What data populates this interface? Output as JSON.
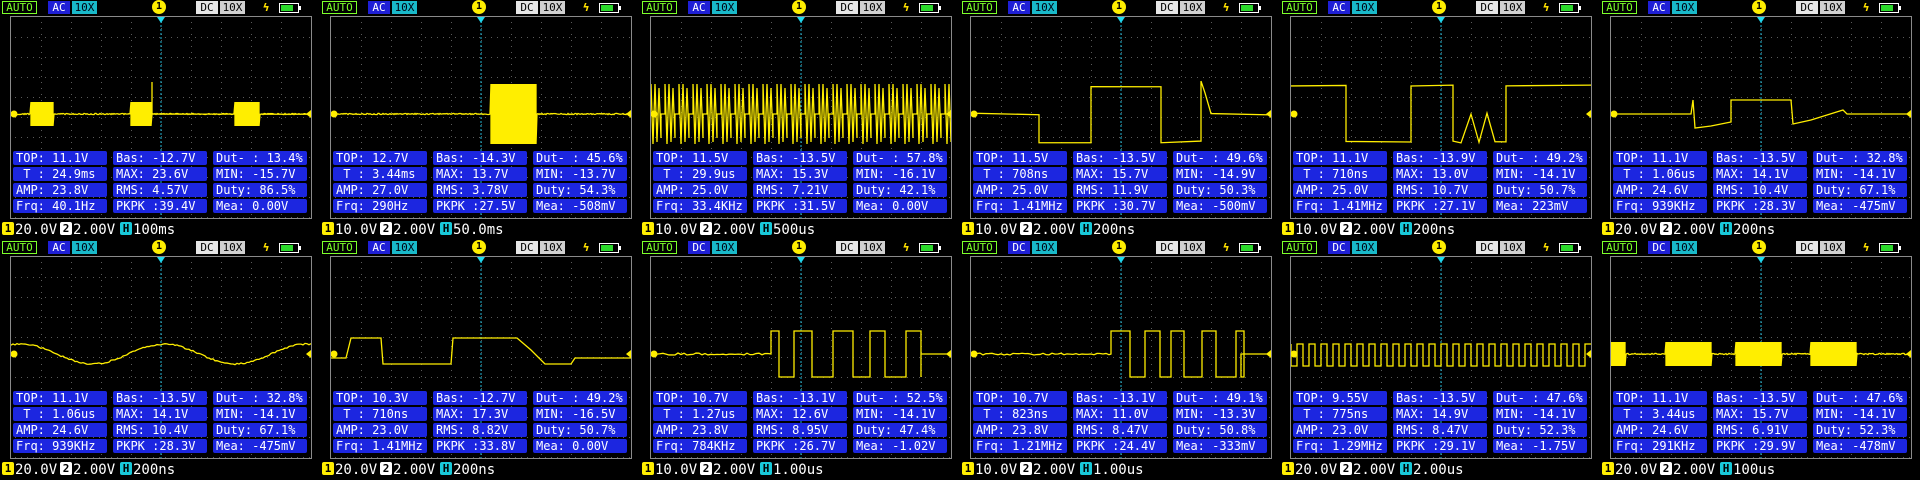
{
  "status": {
    "auto": "AUTO",
    "channel": "1",
    "coupling2": "DC",
    "probe2": "10X",
    "bolt": "ϟ"
  },
  "colors": {
    "trace": "#ffee00",
    "info_bg": "#1c26e0",
    "auto": "#7cff2a",
    "grid": "#5a5a5a"
  },
  "panels": [
    {
      "coupling": "AC",
      "probe": "10X",
      "pattern": "bursts",
      "top": "TOP: 11.1V",
      "bas": "Bas: -12.7V",
      "dut": "Dut- : 13.4%",
      "t": " T : 24.9ms",
      "max": "MAX: 23.6V",
      "min": "MIN: -15.7V",
      "amp": "AMP: 23.8V",
      "rms": "RMS: 4.57V",
      "duty": "Duty: 86.5%",
      "frq": "Frq: 40.1Hz",
      "pkpk": "PKPK :39.4V",
      "meas": "Mea: 0.00V",
      "ch1": "20.0V",
      "ch2": "2.00V",
      "h": "100ms"
    },
    {
      "coupling": "AC",
      "probe": "10X",
      "pattern": "one_burst",
      "top": "TOP: 12.7V",
      "bas": "Bas: -14.3V",
      "dut": "Dut- : 45.6%",
      "t": " T : 3.44ms",
      "max": "MAX: 13.7V",
      "min": "MIN: -13.7V",
      "amp": "AMP: 27.0V",
      "rms": "RMS: 3.78V",
      "duty": "Duty: 54.3%",
      "frq": "Frq: 290Hz",
      "pkpk": "PKPK :27.5V",
      "meas": "Mea: -508mV",
      "ch1": "10.0V",
      "ch2": "2.00V",
      "h": "50.0ms"
    },
    {
      "coupling": "AC",
      "probe": "10X",
      "pattern": "dense",
      "top": "TOP: 11.5V",
      "bas": "Bas: -13.5V",
      "dut": "Dut- : 57.8%",
      "t": " T : 29.9us",
      "max": "MAX: 15.3V",
      "min": "MIN: -16.1V",
      "amp": "AMP: 25.0V",
      "rms": "RMS: 7.21V",
      "duty": "Duty: 42.1%",
      "frq": "Frq: 33.4KHz",
      "pkpk": "PKPK :31.5V",
      "meas": "Mea: 0.00V",
      "ch1": "10.0V",
      "ch2": "2.00V",
      "h": "500us"
    },
    {
      "coupling": "AC",
      "probe": "10X",
      "pattern": "square_a",
      "top": "TOP: 11.5V",
      "bas": "Bas: -13.5V",
      "dut": "Dut- : 49.6%",
      "t": " T : 708ns",
      "max": "MAX: 15.7V",
      "min": "MIN: -14.9V",
      "amp": "AMP: 25.0V",
      "rms": "RMS: 11.9V",
      "duty": "Duty: 50.3%",
      "frq": "Frq: 1.41MHz",
      "pkpk": "PKPK :30.7V",
      "meas": "Mea: -500mV",
      "ch1": "10.0V",
      "ch2": "2.00V",
      "h": "200ns"
    },
    {
      "coupling": "AC",
      "probe": "10X",
      "pattern": "square_b",
      "top": "TOP: 11.1V",
      "bas": "Bas: -13.9V",
      "dut": "Dut- : 49.2%",
      "t": " T : 710ns",
      "max": "MAX: 13.0V",
      "min": "MIN: -14.1V",
      "amp": "AMP: 25.0V",
      "rms": "RMS: 10.7V",
      "duty": "Duty: 50.7%",
      "frq": "Frq: 1.41MHz",
      "pkpk": "PKPK :27.1V",
      "meas": "Mea: 223mV",
      "ch1": "10.0V",
      "ch2": "2.00V",
      "h": "200ns"
    },
    {
      "coupling": "AC",
      "probe": "10X",
      "pattern": "pulse",
      "top": "TOP: 11.1V",
      "bas": "Bas: -13.5V",
      "dut": "Dut- : 32.8%",
      "t": " T : 1.06us",
      "max": "MAX: 14.1V",
      "min": "MIN: -14.1V",
      "amp": "AMP: 24.6V",
      "rms": "RMS: 10.4V",
      "duty": "Duty: 67.1%",
      "frq": "Frq: 939KHz",
      "pkpk": "PKPK :28.3V",
      "meas": "Mea: -475mV",
      "ch1": "20.0V",
      "ch2": "2.00V",
      "h": "200ns"
    },
    {
      "coupling": "AC",
      "probe": "10X",
      "pattern": "sine",
      "top": "TOP: 11.1V",
      "bas": "Bas: -13.5V",
      "dut": "Dut- : 32.8%",
      "t": " T : 1.06us",
      "max": "MAX: 14.1V",
      "min": "MIN: -14.1V",
      "amp": "AMP: 24.6V",
      "rms": "RMS: 10.4V",
      "duty": "Duty: 67.1%",
      "frq": "Frq: 939KHz",
      "pkpk": "PKPK :28.3V",
      "meas": "Mea: -475mV",
      "ch1": "20.0V",
      "ch2": "2.00V",
      "h": "200ns"
    },
    {
      "coupling": "AC",
      "probe": "10X",
      "pattern": "trapezoid",
      "top": "TOP: 10.3V",
      "bas": "Bas: -12.7V",
      "dut": "Dut- : 49.2%",
      "t": " T : 710ns",
      "max": "MAX: 17.3V",
      "min": "MIN: -16.5V",
      "amp": "AMP: 23.0V",
      "rms": "RMS: 8.82V",
      "duty": "Duty: 50.7%",
      "frq": "Frq: 1.41MHz",
      "pkpk": "PKPK :33.8V",
      "meas": "Mea: 0.00V",
      "ch1": "20.0V",
      "ch2": "2.00V",
      "h": "200ns"
    },
    {
      "coupling": "DC",
      "probe": "10X",
      "pattern": "data_a",
      "top": "TOP: 10.7V",
      "bas": "Bas: -13.1V",
      "dut": "Dut- : 52.5%",
      "t": " T : 1.27us",
      "max": "MAX: 12.6V",
      "min": "MIN: -14.1V",
      "amp": "AMP: 23.8V",
      "rms": "RMS: 8.95V",
      "duty": "Duty: 47.4%",
      "frq": "Frq: 784KHz",
      "pkpk": "PKPK :26.7V",
      "meas": "Mea: -1.02V",
      "ch1": "10.0V",
      "ch2": "2.00V",
      "h": "1.00us"
    },
    {
      "coupling": "DC",
      "probe": "10X",
      "pattern": "data_b",
      "top": "TOP: 10.7V",
      "bas": "Bas: -13.1V",
      "dut": "Dut- : 49.1%",
      "t": " T : 823ns",
      "max": "MAX: 11.0V",
      "min": "MIN: -13.3V",
      "amp": "AMP: 23.8V",
      "rms": "RMS: 8.47V",
      "duty": "Duty: 50.8%",
      "frq": "Frq: 1.21MHz",
      "pkpk": "PKPK :24.4V",
      "meas": "Mea: -333mV",
      "ch1": "10.0V",
      "ch2": "2.00V",
      "h": "1.00us"
    },
    {
      "coupling": "DC",
      "probe": "10X",
      "pattern": "square_fine",
      "top": "TOP: 9.55V",
      "bas": "Bas: -13.5V",
      "dut": "Dut- : 47.6%",
      "t": " T : 775ns",
      "max": "MAX: 14.9V",
      "min": "MIN: -14.1V",
      "amp": "AMP: 23.0V",
      "rms": "RMS: 8.47V",
      "duty": "Duty: 52.3%",
      "frq": "Frq: 1.29MHz",
      "pkpk": "PKPK :29.1V",
      "meas": "Mea: -1.75V",
      "ch1": "20.0V",
      "ch2": "2.00V",
      "h": "2.00us"
    },
    {
      "coupling": "DC",
      "probe": "10X",
      "pattern": "bursts_wide",
      "top": "TOP: 11.1V",
      "bas": "Bas: -13.5V",
      "dut": "Dut- : 47.6%",
      "t": " T : 3.44us",
      "max": "MAX: 15.7V",
      "min": "MIN: -14.1V",
      "amp": "AMP: 24.6V",
      "rms": "RMS: 6.91V",
      "duty": "Duty: 52.3%",
      "frq": "Frq: 291KHz",
      "pkpk": "PKPK :29.9V",
      "meas": "Mea: -478mV",
      "ch1": "20.0V",
      "ch2": "2.00V",
      "h": "100us"
    }
  ]
}
